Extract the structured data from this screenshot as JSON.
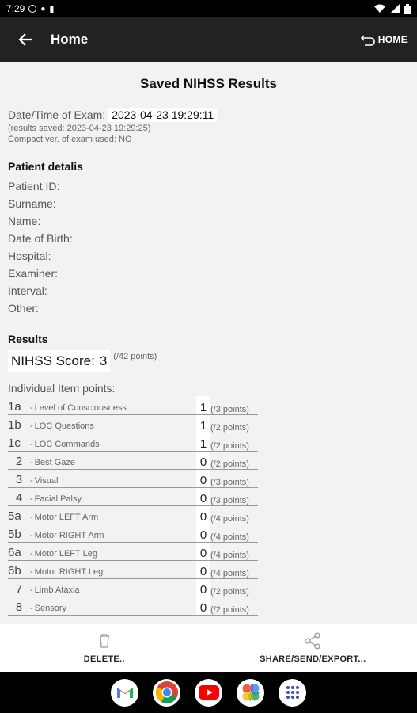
{
  "status": {
    "time": "7:29"
  },
  "appbar": {
    "title": "Home",
    "home_label": "HOME"
  },
  "header": {
    "title": "Saved NIHSS Results",
    "exam_label": "Date/Time of Exam:",
    "exam_value": "2023-04-23 19:29:11",
    "saved_note": "(results saved: 2023-04-23 19:29:25)",
    "compact_note": "Compact ver. of exam used: NO"
  },
  "patient": {
    "heading": "Patient detalis",
    "fields": [
      "Patient ID:",
      "Surname:",
      "Name:",
      "Date of Birth:",
      "Hospital:",
      "Examiner:",
      "Interval:",
      "Other:"
    ]
  },
  "results": {
    "heading": "Results",
    "score_label": "NIHSS Score:",
    "score_value": "3",
    "score_max": "(/42 points)",
    "items_heading": "Individual Item points:",
    "items": [
      {
        "code": "1a",
        "desc": "Level of Consciousness",
        "value": "1",
        "max": "(/3 points)"
      },
      {
        "code": "1b",
        "desc": "LOC Questions",
        "value": "1",
        "max": "(/2 points)"
      },
      {
        "code": "1c",
        "desc": "LOC Commands",
        "value": "1",
        "max": "(/2 points)"
      },
      {
        "code": "2",
        "desc": "Best Gaze",
        "value": "0",
        "max": "(/2 points)"
      },
      {
        "code": "3",
        "desc": "Visual",
        "value": "0",
        "max": "(/3 points)"
      },
      {
        "code": "4",
        "desc": "Facial Palsy",
        "value": "0",
        "max": "(/3 points)"
      },
      {
        "code": "5a",
        "desc": "Motor LEFT Arm",
        "value": "0",
        "max": "(/4 points)"
      },
      {
        "code": "5b",
        "desc": "Motor RIGHT Arm",
        "value": "0",
        "max": "(/4 points)"
      },
      {
        "code": "6a",
        "desc": "Motor LEFT Leg",
        "value": "0",
        "max": "(/4 points)"
      },
      {
        "code": "6b",
        "desc": "Motor RIGHT Leg",
        "value": "0",
        "max": "(/4 points)"
      },
      {
        "code": "7",
        "desc": "Limb Ataxia",
        "value": "0",
        "max": "(/2 points)"
      },
      {
        "code": "8",
        "desc": "Sensory",
        "value": "0",
        "max": "(/2 points)"
      }
    ]
  },
  "bottom_actions": {
    "delete_label": "DELETE..",
    "share_label": "SHARE/SEND/EXPORT..."
  },
  "dock": {
    "apps": [
      "gmail-icon",
      "chrome-icon",
      "youtube-icon",
      "photos-icon",
      "app-drawer-icon"
    ]
  }
}
